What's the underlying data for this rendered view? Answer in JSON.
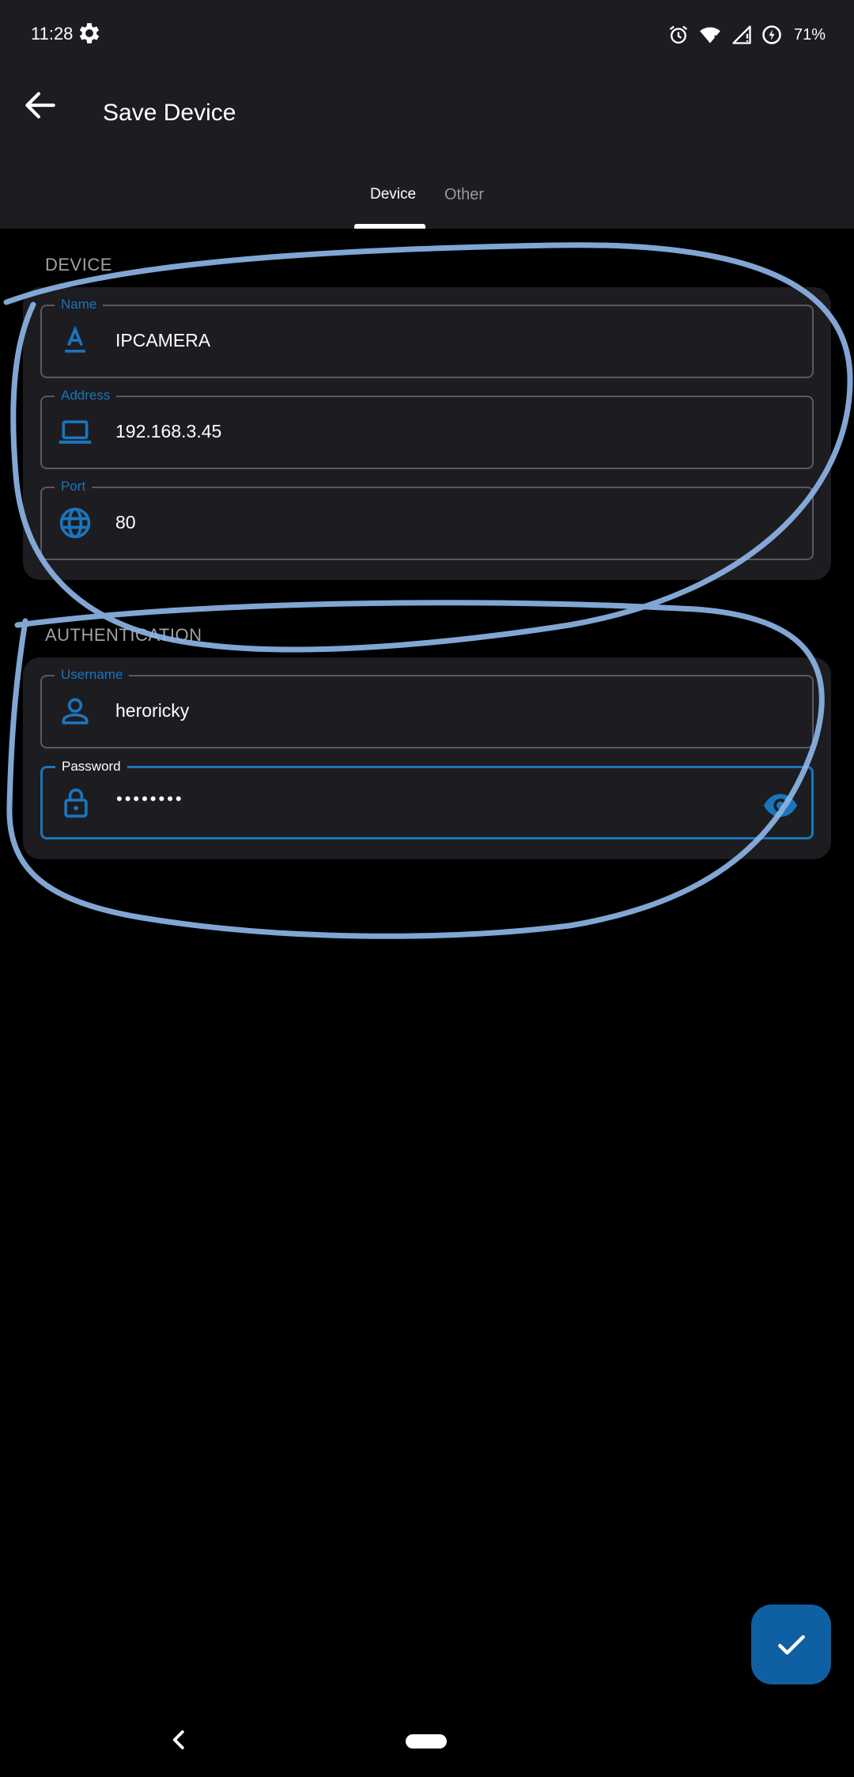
{
  "status_bar": {
    "time": "11:28",
    "battery_percent": "71%",
    "icons": [
      "gear-icon",
      "alarm-icon",
      "wifi-icon",
      "signal-icon",
      "battery-saver-icon"
    ]
  },
  "app_bar": {
    "title": "Save Device",
    "back_icon": "arrow-left-icon"
  },
  "tabs": [
    {
      "label": "Device",
      "selected": true
    },
    {
      "label": "Other",
      "selected": false
    }
  ],
  "sections": {
    "device": {
      "label": "DEVICE",
      "fields": [
        {
          "label": "Name",
          "value": "IPCAMERA",
          "icon": "text-format-icon"
        },
        {
          "label": "Address",
          "value": "192.168.3.45",
          "icon": "laptop-icon"
        },
        {
          "label": "Port",
          "value": "80",
          "icon": "globe-icon"
        }
      ]
    },
    "authentication": {
      "label": "AUTHENTICATION",
      "fields": [
        {
          "label": "Username",
          "value": "heroricky",
          "icon": "person-icon"
        },
        {
          "label": "Password",
          "value": "••••••••",
          "icon": "lock-icon",
          "focused": true,
          "trailing_icon": "eye-icon"
        }
      ]
    }
  },
  "fab": {
    "icon": "check-icon"
  },
  "colors": {
    "accent": "#1b75bb",
    "fab": "#0f5fa3",
    "surface": "#1d1c21",
    "background": "#000000",
    "annotation": "#8fb8ea"
  },
  "nav_bar": {
    "icons": [
      "nav-back-icon",
      "nav-home-pill"
    ]
  }
}
